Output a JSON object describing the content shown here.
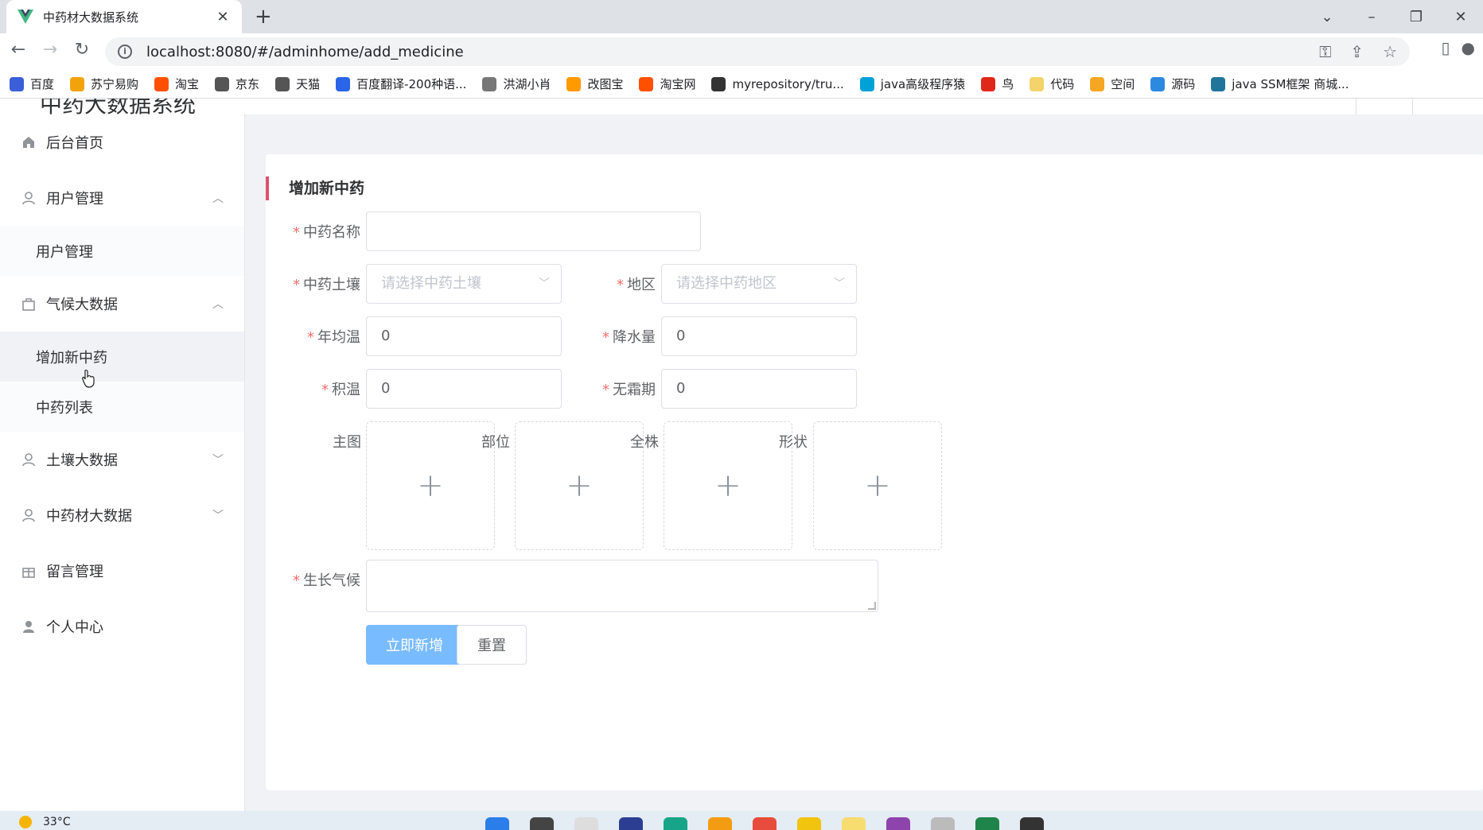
{
  "browser": {
    "tab_title": "中药材大数据系统",
    "url": "localhost:8080/#/adminhome/add_medicine",
    "bookmarks": [
      {
        "label": "百度",
        "color": "#3b5ed9"
      },
      {
        "label": "苏宁易购",
        "color": "#f2a20c"
      },
      {
        "label": "淘宝",
        "color": "#ff5000"
      },
      {
        "label": "京东",
        "color": "#555555"
      },
      {
        "label": "天猫",
        "color": "#555555"
      },
      {
        "label": "百度翻译-200种语...",
        "color": "#2a64e8"
      },
      {
        "label": "洪湖小肖",
        "color": "#777777"
      },
      {
        "label": "改图宝",
        "color": "#ff9a00"
      },
      {
        "label": "淘宝网",
        "color": "#ff5000"
      },
      {
        "label": "myrepository/tru...",
        "color": "#333333"
      },
      {
        "label": "java高级程序猿",
        "color": "#00a1d6"
      },
      {
        "label": "鸟",
        "color": "#e0281a"
      },
      {
        "label": "代码",
        "color": "#f3d36a"
      },
      {
        "label": "空间",
        "color": "#f5a623"
      },
      {
        "label": "源码",
        "color": "#2b8ae0"
      },
      {
        "label": "java SSM框架 商城...",
        "color": "#21759b"
      }
    ]
  },
  "app": {
    "title": "中药大数据系统"
  },
  "sidebar": {
    "items": [
      {
        "label": "后台首页",
        "icon": "home-icon"
      },
      {
        "label": "用户管理",
        "icon": "user-icon",
        "expanded": true,
        "children": [
          "用户管理"
        ]
      },
      {
        "label": "气候大数据",
        "icon": "bag-icon",
        "expanded": true,
        "children": [
          "增加新中药",
          "中药列表"
        ]
      },
      {
        "label": "土壤大数据",
        "icon": "user-icon",
        "expanded": false
      },
      {
        "label": "中药材大数据",
        "icon": "user-icon",
        "expanded": false
      },
      {
        "label": "留言管理",
        "icon": "gift-icon"
      },
      {
        "label": "个人中心",
        "icon": "person-filled-icon"
      }
    ],
    "active_child": "增加新中药"
  },
  "form": {
    "title": "增加新中药",
    "name_label": "中药名称",
    "name_value": "",
    "soil_label": "中药土壤",
    "soil_placeholder": "请选择中药土壤",
    "region_label": "地区",
    "region_placeholder": "请选择中药地区",
    "temp_label": "年均温",
    "temp_value": "0",
    "rain_label": "降水量",
    "rain_value": "0",
    "accum_label": "积温",
    "accum_value": "0",
    "frost_label": "无霜期",
    "frost_value": "0",
    "upload_labels": [
      "主图",
      "部位",
      "全株",
      "形状"
    ],
    "climate_label": "生长气候",
    "submit_label": "立即新增",
    "reset_label": "重置"
  },
  "taskbar": {
    "weather": "33°C"
  },
  "colors": {
    "accent": "#e0516b",
    "primary_button": "#79bbff",
    "required": "#f56c6c"
  }
}
